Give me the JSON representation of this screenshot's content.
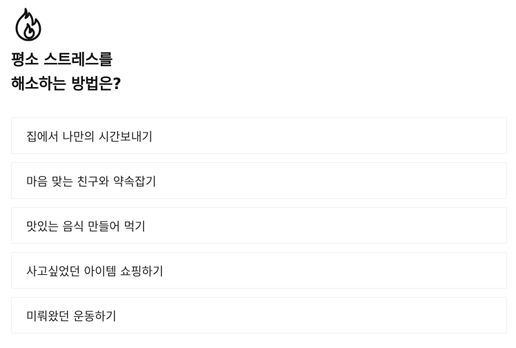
{
  "header": {
    "icon": "fire-icon",
    "question_line1": "평소 스트레스를",
    "question_line2": "해소하는 방법은?"
  },
  "options": [
    {
      "label": "집에서 나만의 시간보내기"
    },
    {
      "label": "마음 맞는 친구와 약속잡기"
    },
    {
      "label": "맛있는 음식 만들어 먹기"
    },
    {
      "label": "사고싶었던 아이템 쇼핑하기"
    },
    {
      "label": "미뤄왔던 운동하기"
    }
  ]
}
